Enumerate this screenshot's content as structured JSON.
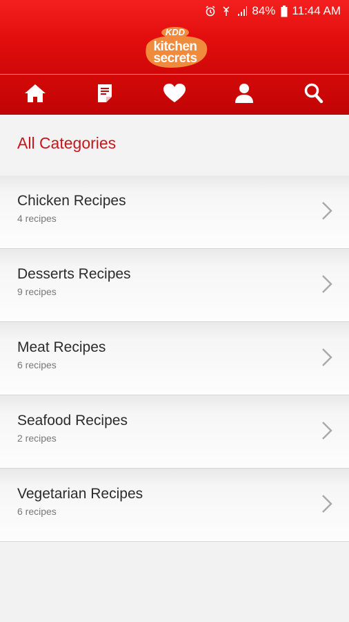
{
  "status_bar": {
    "battery": "84%",
    "time": "11:44 AM"
  },
  "header": {
    "brand_top": "KDD",
    "brand_line1": "kitchen",
    "brand_line2": "secrets",
    "colors": {
      "primary": "#e10d0d",
      "accent_orange": "#f08a3c",
      "title_red": "#c6161c"
    }
  },
  "nav": {
    "items": [
      {
        "icon": "home-icon"
      },
      {
        "icon": "notes-icon"
      },
      {
        "icon": "heart-icon"
      },
      {
        "icon": "user-icon"
      },
      {
        "icon": "search-icon"
      }
    ]
  },
  "page": {
    "title": "All Categories"
  },
  "categories": [
    {
      "name": "Chicken Recipes",
      "count": "4 recipes"
    },
    {
      "name": "Desserts Recipes",
      "count": "9 recipes"
    },
    {
      "name": "Meat Recipes",
      "count": "6 recipes"
    },
    {
      "name": "Seafood Recipes",
      "count": "2 recipes"
    },
    {
      "name": "Vegetarian Recipes",
      "count": "6 recipes"
    }
  ]
}
